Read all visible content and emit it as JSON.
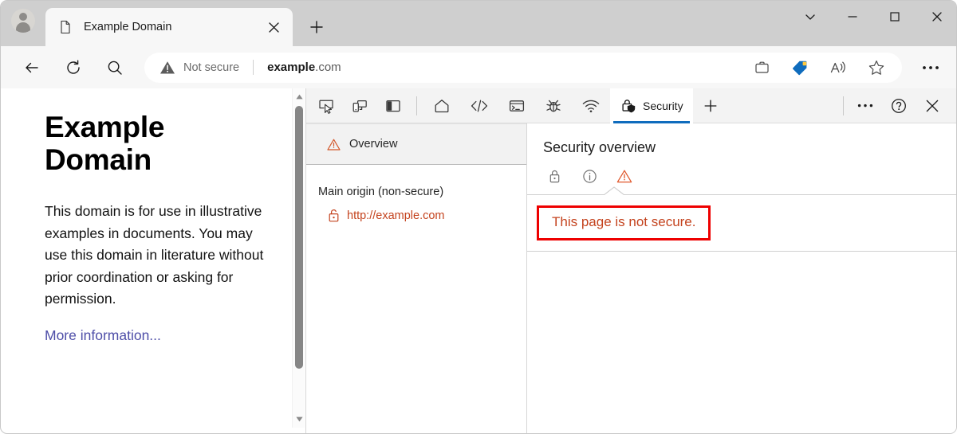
{
  "browser": {
    "profile": {
      "name": "profile-avatar"
    },
    "tab": {
      "title": "Example Domain",
      "favicon": "document-icon",
      "close_label": "close-tab"
    },
    "new_tab_label": "new-tab",
    "window_controls": {
      "more": "chevron-down",
      "minimize": "minimize",
      "maximize": "maximize",
      "close": "close"
    },
    "nav": {
      "back": "back-arrow",
      "refresh": "refresh",
      "search": "search"
    },
    "omnibox": {
      "security_state": "Not secure",
      "security_icon": "warning-triangle-filled",
      "url_host": "example",
      "url_tld": ".com",
      "url_full": "example.com",
      "right_icons": [
        "collections-icon",
        "shopping-tag-icon",
        "read-aloud-icon",
        "favorites-star-icon"
      ]
    },
    "settings_more": "settings-and-more"
  },
  "page": {
    "heading": "Example Domain",
    "paragraph": "This domain is for use in illustrative examples in documents. You may use this domain in literature without prior coordination or asking for permission.",
    "link_text": "More information...",
    "link_color": "#4e4ea8",
    "scrollbar": {
      "up_arrow": "scroll-up-arrow",
      "down_arrow": "scroll-down-arrow",
      "thumb_color": "#868686"
    }
  },
  "devtools": {
    "toolbar_left_icons": [
      {
        "name": "inspect-element-icon",
        "label": "Inspect"
      },
      {
        "name": "device-emulation-icon",
        "label": "Device emulation"
      },
      {
        "name": "dock-side-icon",
        "label": "Dock side"
      }
    ],
    "tabs": [
      {
        "name": "tab-welcome",
        "icon": "home-icon",
        "label": "",
        "active": false
      },
      {
        "name": "tab-elements",
        "icon": "elements-code-icon",
        "label": "",
        "active": false
      },
      {
        "name": "tab-console",
        "icon": "console-terminal-icon",
        "label": "",
        "active": false
      },
      {
        "name": "tab-sources",
        "icon": "debugger-bug-icon",
        "label": "",
        "active": false
      },
      {
        "name": "tab-network",
        "icon": "network-wifi-icon",
        "label": "",
        "active": false
      },
      {
        "name": "tab-security",
        "icon": "security-lock-shield-icon",
        "label": "Security",
        "active": true
      }
    ],
    "add_tab_label": "more-tools",
    "toolbar_right": {
      "more": "more-options-ellipsis",
      "help": "help-question-icon",
      "close": "close-devtools-icon"
    },
    "sidebar": {
      "items": [
        {
          "name": "sidebar-item-overview",
          "label": "Overview",
          "icon": "warning-triangle-icon",
          "selected": true
        }
      ],
      "group_title": "Main origin (non-secure)",
      "origins": [
        {
          "name": "origin-link",
          "label": "http://example.com",
          "icon": "unlocked-padlock-icon",
          "color": "#c4431e"
        }
      ]
    },
    "main": {
      "title": "Security overview",
      "status_icons": [
        {
          "name": "secure-lock-icon",
          "state": "inactive",
          "color": "#707070"
        },
        {
          "name": "info-circle-icon",
          "state": "inactive",
          "color": "#707070"
        },
        {
          "name": "warning-triangle-icon",
          "state": "active",
          "color": "#e0562a"
        }
      ],
      "message": "This page is not secure.",
      "message_color": "#c4431e",
      "highlight_border_color": "#ee0000"
    }
  }
}
